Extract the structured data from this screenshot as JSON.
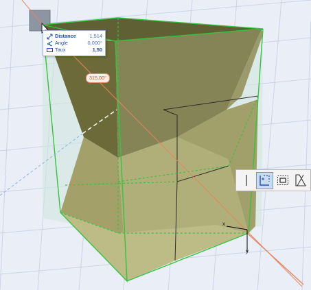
{
  "tracker": {
    "rows": [
      {
        "icon": "distance-icon",
        "label": "Distance",
        "value": "1,514"
      },
      {
        "icon": "angle-icon",
        "label": "Angle",
        "value": "0,000°"
      },
      {
        "icon": "rate-icon",
        "label": "Taux",
        "value": "1,50"
      }
    ]
  },
  "angle_badge": "315,00°",
  "axes": {
    "x": "x",
    "y": "y"
  },
  "pet_palette": {
    "buttons": [
      {
        "name": "move-edge-icon",
        "active": false
      },
      {
        "name": "offset-edge-icon",
        "active": true
      },
      {
        "name": "offset-all-edges-icon",
        "active": false
      },
      {
        "name": "skew-icon",
        "active": false
      }
    ]
  },
  "colors": {
    "background": "#e9eef7",
    "solid_fill": "#a7a56c",
    "selection_box": "#37c23f",
    "guide_line": "#e8845f"
  }
}
